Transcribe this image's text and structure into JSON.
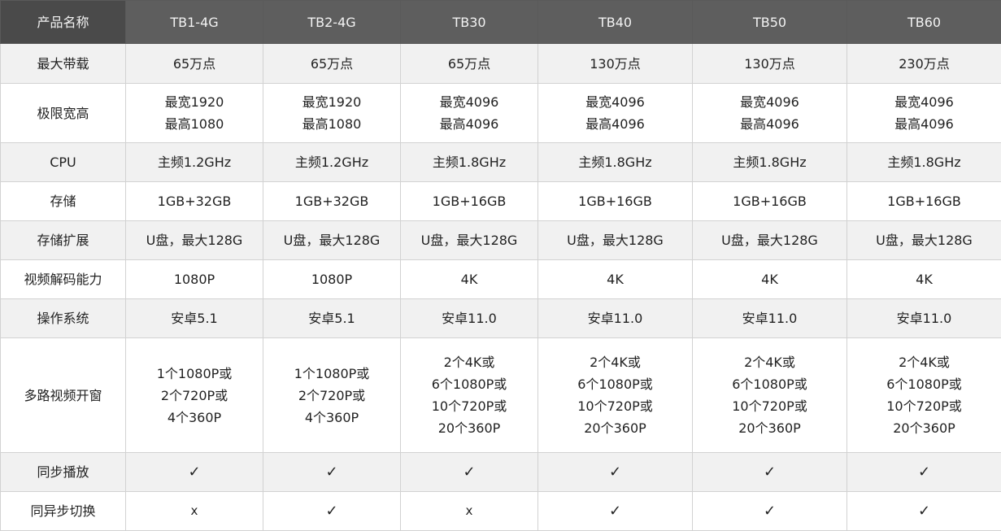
{
  "table": {
    "header_label": "产品名称",
    "models": [
      "TB1-4G",
      "TB2-4G",
      "TB30",
      "TB40",
      "TB50",
      "TB60"
    ],
    "rows": [
      {
        "label": "最大带载",
        "values": [
          "65万点",
          "65万点",
          "65万点",
          "130万点",
          "130万点",
          "230万点"
        ]
      },
      {
        "label": "极限宽高",
        "values": [
          "最宽1920\n最高1080",
          "最宽1920\n最高1080",
          "最宽4096\n最高4096",
          "最宽4096\n最高4096",
          "最宽4096\n最高4096",
          "最宽4096\n最高4096"
        ]
      },
      {
        "label": "CPU",
        "values": [
          "主频1.2GHz",
          "主频1.2GHz",
          "主频1.8GHz",
          "主频1.8GHz",
          "主频1.8GHz",
          "主频1.8GHz"
        ]
      },
      {
        "label": "存储",
        "values": [
          "1GB+32GB",
          "1GB+32GB",
          "1GB+16GB",
          "1GB+16GB",
          "1GB+16GB",
          "1GB+16GB"
        ]
      },
      {
        "label": "存储扩展",
        "values": [
          "U盘，最大128G",
          "U盘，最大128G",
          "U盘，最大128G",
          "U盘，最大128G",
          "U盘，最大128G",
          "U盘，最大128G"
        ]
      },
      {
        "label": "视频解码能力",
        "values": [
          "1080P",
          "1080P",
          "4K",
          "4K",
          "4K",
          "4K"
        ]
      },
      {
        "label": "操作系统",
        "values": [
          "安卓5.1",
          "安卓5.1",
          "安卓11.0",
          "安卓11.0",
          "安卓11.0",
          "安卓11.0"
        ]
      },
      {
        "label": "多路视频开窗",
        "values": [
          "1个1080P或\n2个720P或\n4个360P",
          "1个1080P或\n2个720P或\n4个360P",
          "2个4K或\n6个1080P或\n10个720P或\n20个360P",
          "2个4K或\n6个1080P或\n10个720P或\n20个360P",
          "2个4K或\n6个1080P或\n10个720P或\n20个360P",
          "2个4K或\n6个1080P或\n10个720P或\n20个360P"
        ]
      },
      {
        "label": "同步播放",
        "values": [
          "✓",
          "✓",
          "✓",
          "✓",
          "✓",
          "✓"
        ]
      },
      {
        "label": "同异步切换",
        "values": [
          "x",
          "✓",
          "x",
          "✓",
          "✓",
          "✓"
        ]
      }
    ]
  },
  "colors": {
    "header_label_bg": "#4a4a4a",
    "header_model_bg": "#5e5e5e",
    "header_text": "#f2f2f2",
    "alt_row_bg": "#f1f1f1",
    "row_bg": "#ffffff",
    "border": "#d2d2d2",
    "text": "#222222"
  }
}
